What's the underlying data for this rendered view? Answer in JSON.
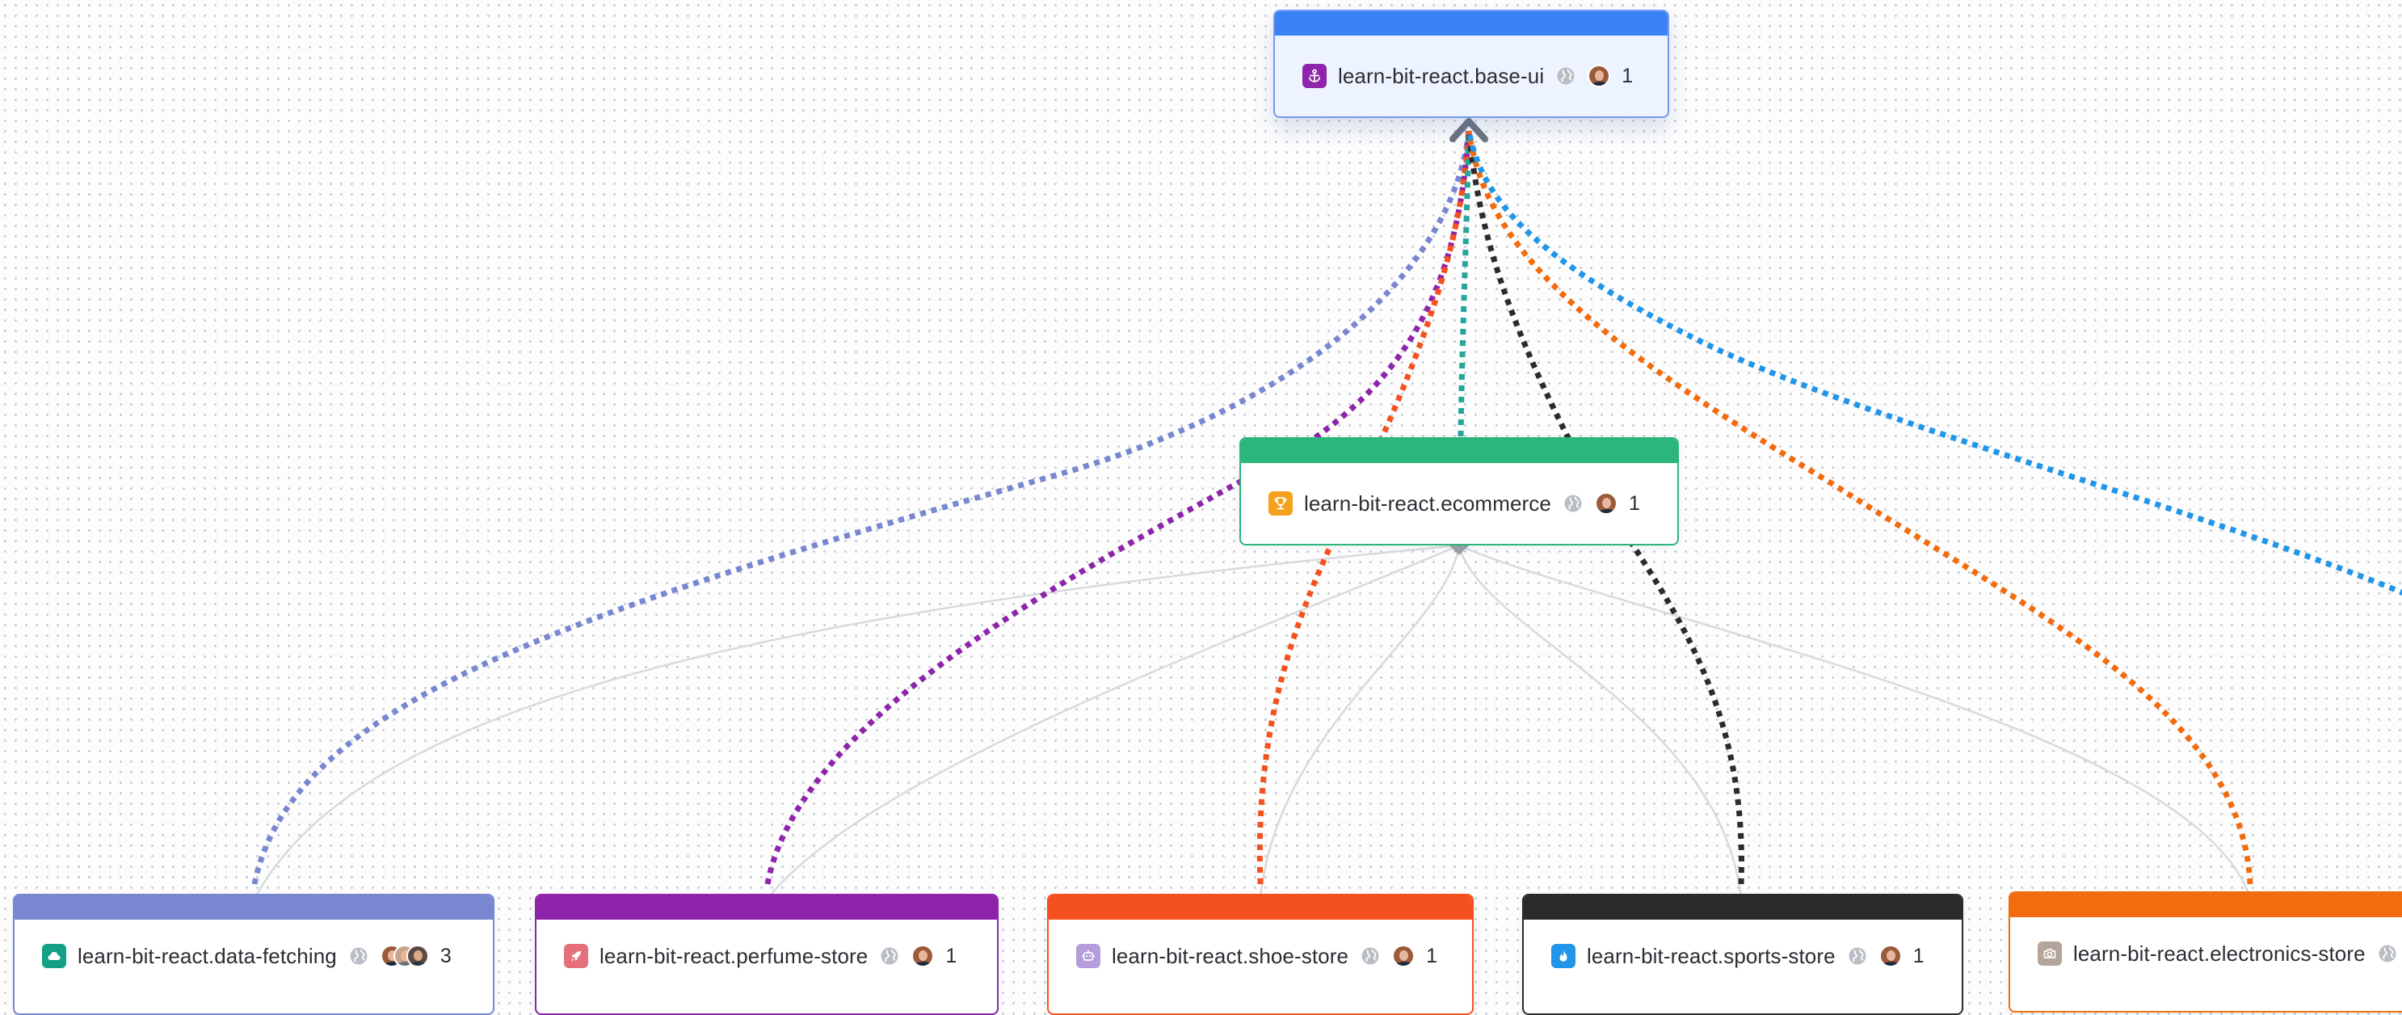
{
  "colors": {
    "base_ui": "#3b82f6",
    "ecommerce": "#2cb67d",
    "data_fetching": "#7887cf",
    "perfume_store": "#8e24aa",
    "shoe_store": "#f4511e",
    "sports_store": "#2b2b2b",
    "electronics_store": "#f26b0f",
    "edge_to_ecommerce_light": "#d7dadf",
    "edge_teal": "#26a69a",
    "edge_sky": "#2196e8"
  },
  "nodes": {
    "base_ui": {
      "name": "learn-bit-react.base-ui",
      "icon": "anchor-icon",
      "count": "1"
    },
    "ecommerce": {
      "name": "learn-bit-react.ecommerce",
      "icon": "trophy-icon",
      "count": "1"
    },
    "data_fetching": {
      "name": "learn-bit-react.data-fetching",
      "icon": "cloud-icon",
      "count": "3"
    },
    "perfume_store": {
      "name": "learn-bit-react.perfume-store",
      "icon": "rocket-icon",
      "count": "1"
    },
    "shoe_store": {
      "name": "learn-bit-react.shoe-store",
      "icon": "robot-icon",
      "count": "1"
    },
    "sports_store": {
      "name": "learn-bit-react.sports-store",
      "icon": "flame-icon",
      "count": "1"
    },
    "electronics_store": {
      "name": "learn-bit-react.electronics-store",
      "icon": "camera-icon"
    }
  }
}
